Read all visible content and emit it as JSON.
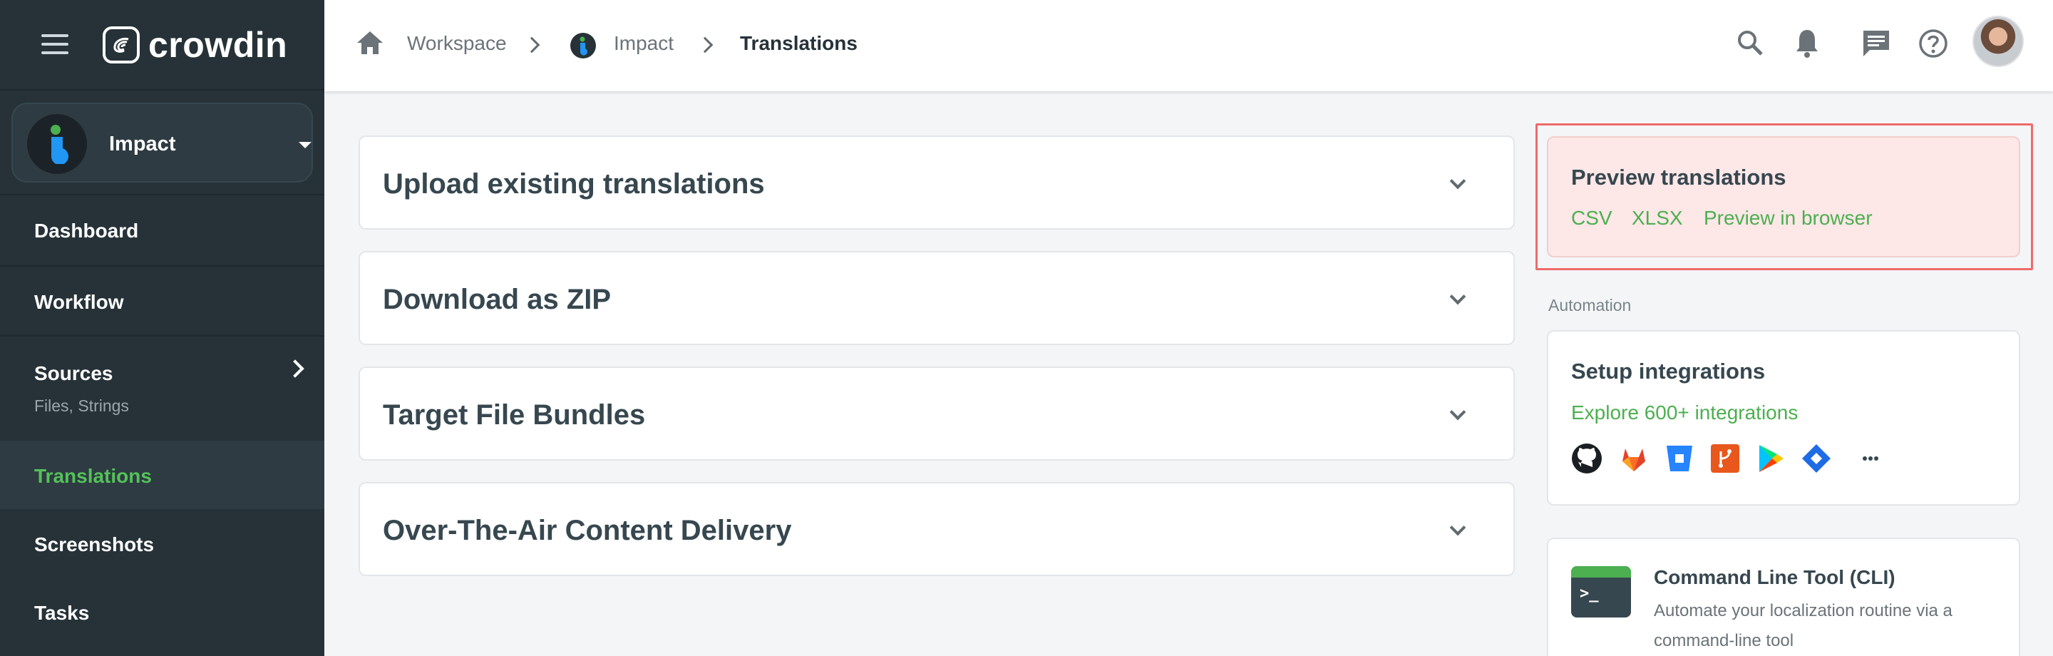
{
  "sidebar": {
    "logo_text": "crowdin",
    "project": {
      "name": "Impact"
    },
    "items": [
      {
        "label": "Dashboard",
        "sub": ""
      },
      {
        "label": "Workflow",
        "sub": ""
      },
      {
        "label": "Sources",
        "sub": "Files, Strings"
      },
      {
        "label": "Translations",
        "sub": "",
        "active": true
      },
      {
        "label": "Screenshots",
        "sub": ""
      },
      {
        "label": "Tasks",
        "sub": ""
      }
    ]
  },
  "breadcrumb": {
    "items": [
      "Workspace",
      "Impact",
      "Translations"
    ]
  },
  "topbar_icons": [
    "search-icon",
    "bell-icon",
    "message-icon",
    "help-icon",
    "avatar"
  ],
  "main": {
    "cards": [
      {
        "title": "Upload existing translations"
      },
      {
        "title": "Download as ZIP"
      },
      {
        "title": "Target File Bundles"
      },
      {
        "title": "Over-The-Air Content Delivery"
      }
    ]
  },
  "right": {
    "preview": {
      "title": "Preview translations",
      "links": [
        "CSV",
        "XLSX",
        "Preview in browser"
      ]
    },
    "automation_label": "Automation",
    "integrations": {
      "title": "Setup integrations",
      "link": "Explore 600+ integrations",
      "icons": [
        "github-icon",
        "gitlab-icon",
        "bitbucket-icon",
        "git-icon",
        "google-play-icon",
        "jira-icon",
        "more-icon"
      ]
    },
    "cli": {
      "title": "Command Line Tool (CLI)",
      "description": "Automate your localization routine via a command-line tool"
    }
  },
  "colors": {
    "sidebar_bg": "#263238",
    "accent_green": "#4caf50",
    "highlight_red": "#ee6a6a"
  }
}
